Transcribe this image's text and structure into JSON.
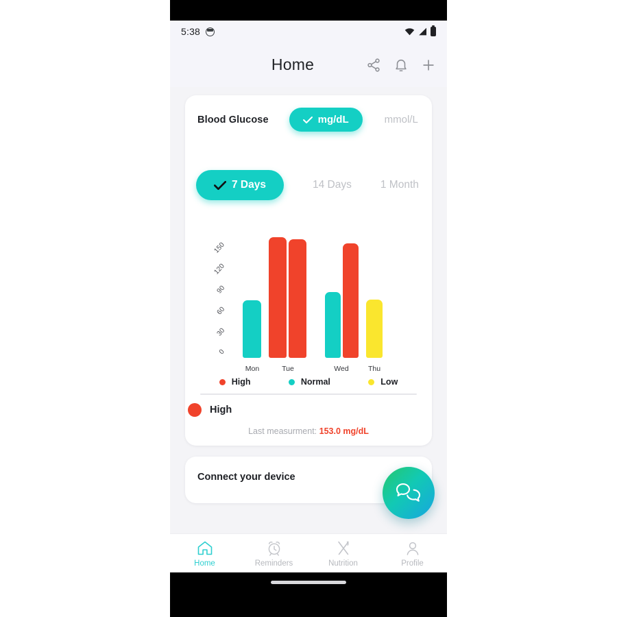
{
  "status_bar": {
    "time": "5:38",
    "icons": [
      "screen-record-icon",
      "wifi-icon",
      "signal-icon",
      "battery-icon"
    ]
  },
  "app_bar": {
    "title": "Home",
    "actions": [
      {
        "name": "share-icon",
        "label": "Share"
      },
      {
        "name": "bell-icon",
        "label": "Notifications"
      },
      {
        "name": "plus-icon",
        "label": "Add"
      }
    ]
  },
  "glucose_card": {
    "title": "Blood Glucose",
    "units": [
      {
        "label": "mg/dL",
        "selected": true
      },
      {
        "label": "mmol/L",
        "selected": false
      }
    ],
    "ranges": [
      {
        "label": "7 Days",
        "selected": true
      },
      {
        "label": "14 Days",
        "selected": false
      },
      {
        "label": "1 Month",
        "selected": false
      }
    ],
    "legend": [
      {
        "label": "High",
        "color": "#f0432b"
      },
      {
        "label": "Normal",
        "color": "#14cfc4"
      },
      {
        "label": "Low",
        "color": "#fae62e"
      }
    ],
    "status": {
      "label": "High",
      "color": "#f0432b"
    },
    "last_measurement_prefix": "Last measurment: ",
    "last_measurement_value": "153.0 mg/dL"
  },
  "chart_data": {
    "type": "bar",
    "title": "Blood Glucose",
    "xlabel": "",
    "ylabel": "",
    "ylim": [
      0,
      165
    ],
    "yticks": [
      150,
      120,
      90,
      60,
      30,
      0
    ],
    "grid": false,
    "legend_position": "bottom",
    "categories": [
      "Mon",
      "Tue",
      "Wed",
      "Thu"
    ],
    "bars": [
      {
        "category": "Mon",
        "value": 78,
        "status": "Normal",
        "color": "#14cfc4"
      },
      {
        "category": "Tue",
        "value": 163,
        "status": "High",
        "color": "#f0432b"
      },
      {
        "category": "Tue",
        "value": 160,
        "status": "High",
        "color": "#f0432b"
      },
      {
        "category": "Wed",
        "value": 89,
        "status": "Normal",
        "color": "#14cfc4"
      },
      {
        "category": "Wed",
        "value": 155,
        "status": "High",
        "color": "#f0432b"
      },
      {
        "category": "Thu",
        "value": 79,
        "status": "Low",
        "color": "#fae62e"
      }
    ],
    "series": [
      {
        "name": "High",
        "color": "#f0432b",
        "values": [
          null,
          163,
          155,
          null
        ]
      },
      {
        "name": "Normal",
        "color": "#14cfc4",
        "values": [
          78,
          null,
          89,
          null
        ]
      },
      {
        "name": "Low",
        "color": "#fae62e",
        "values": [
          null,
          null,
          null,
          79
        ]
      }
    ]
  },
  "connect_card": {
    "title": "Connect your device"
  },
  "fab": {
    "name": "chat-bubbles-icon",
    "label": "Chat"
  },
  "bottom_nav": [
    {
      "label": "Home",
      "icon": "home-icon",
      "active": true
    },
    {
      "label": "Reminders",
      "icon": "alarm-clock-icon",
      "active": false
    },
    {
      "label": "Nutrition",
      "icon": "fork-knife-icon",
      "active": false
    },
    {
      "label": "Profile",
      "icon": "person-icon",
      "active": false
    }
  ],
  "colors": {
    "accent": "#14cfc4",
    "high": "#f0432b",
    "normal": "#14cfc4",
    "low": "#fae62e",
    "page_bg": "#f4f4f7"
  }
}
